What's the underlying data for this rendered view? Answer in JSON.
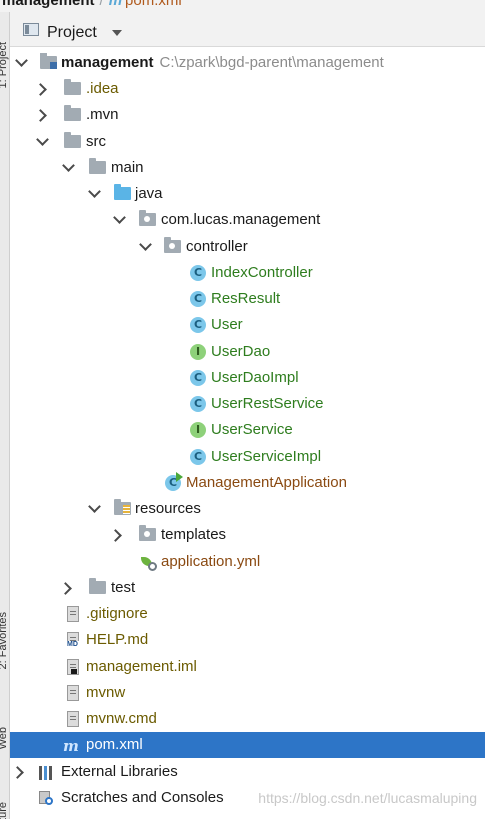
{
  "breadcrumb": {
    "module": "management",
    "file": "pom.xml",
    "file_icon": "m"
  },
  "side_tabs": {
    "project": "1: Project",
    "favorites": "2: Favorites",
    "web": "Web",
    "structure": "Structure"
  },
  "panel": {
    "title": "Project"
  },
  "tree": {
    "root": {
      "label": "management",
      "path": "C:\\zpark\\bgd-parent\\management"
    },
    "idea": ".idea",
    "mvn": ".mvn",
    "src": "src",
    "main": "main",
    "java": "java",
    "package": "com.lucas.management",
    "controller": "controller",
    "classes": [
      {
        "label": "IndexController",
        "kind": "C"
      },
      {
        "label": "ResResult",
        "kind": "C"
      },
      {
        "label": "User",
        "kind": "C"
      },
      {
        "label": "UserDao",
        "kind": "I"
      },
      {
        "label": "UserDaoImpl",
        "kind": "C"
      },
      {
        "label": "UserRestService",
        "kind": "C"
      },
      {
        "label": "UserService",
        "kind": "I"
      },
      {
        "label": "UserServiceImpl",
        "kind": "C"
      }
    ],
    "app_class": "ManagementApplication",
    "resources": "resources",
    "templates": "templates",
    "application_yml": "application.yml",
    "test": "test",
    "files": [
      {
        "label": ".gitignore"
      },
      {
        "label": "HELP.md"
      },
      {
        "label": "management.iml"
      },
      {
        "label": "mvnw"
      },
      {
        "label": "mvnw.cmd"
      }
    ],
    "pom": "pom.xml",
    "external_libraries": "External Libraries",
    "scratches": "Scratches and Consoles"
  },
  "watermark": "https://blog.csdn.net/lucasmaluping",
  "colors": {
    "selection": "#2d75c7",
    "class_green": "#2e7d1e",
    "app_brown": "#8a4a12",
    "file_olive": "#6b5b00"
  }
}
